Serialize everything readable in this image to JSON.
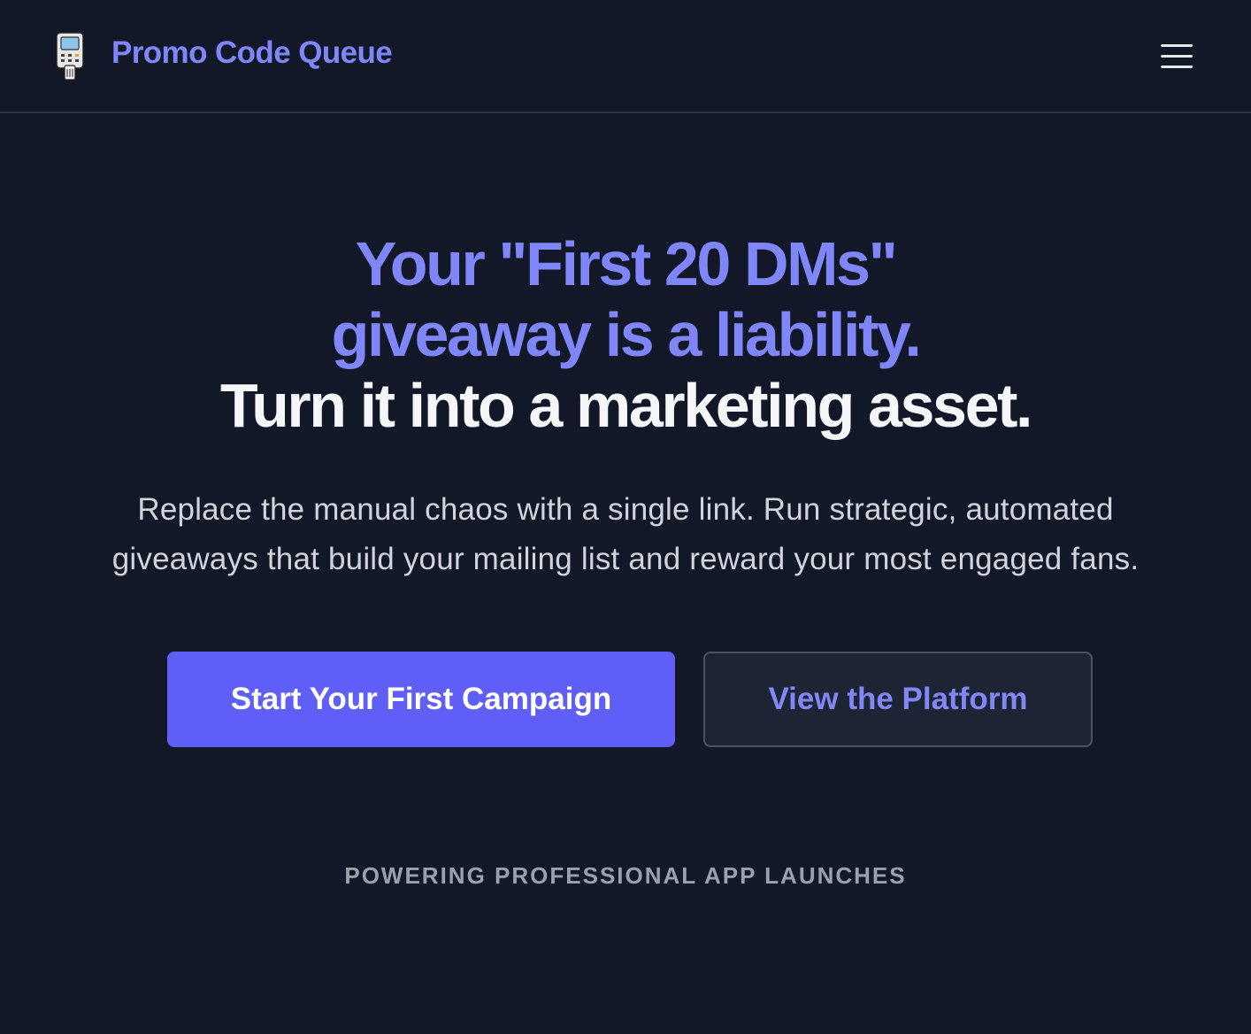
{
  "header": {
    "brand": "Promo Code Queue",
    "logo_icon": "card-reader-icon",
    "menu_icon": "hamburger-menu-icon"
  },
  "hero": {
    "title_line1": "Your \"First 20 DMs\"",
    "title_line2": "giveaway is a liability.",
    "title_line3": "Turn it into a marketing asset.",
    "subtitle_line1": "Replace the manual chaos with a single link. Run strategic, automated",
    "subtitle_line2": "giveaways that build your mailing list and reward your most engaged fans."
  },
  "actions": {
    "primary_label": "Start Your First Campaign",
    "secondary_label": "View the Platform"
  },
  "tagline": "POWERING PROFESSIONAL APP LAUNCHES",
  "colors": {
    "background": "#121828",
    "accent": "#7f86f8",
    "primary_button": "#5f5ef6",
    "secondary_button": "#1d2535"
  }
}
